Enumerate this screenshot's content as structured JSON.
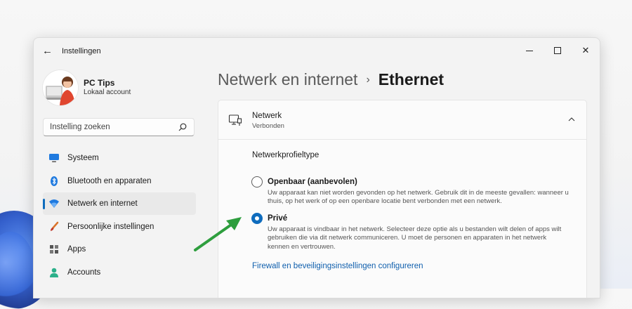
{
  "window": {
    "title": "Instellingen"
  },
  "user": {
    "name": "PC Tips",
    "account_type": "Lokaal account"
  },
  "search": {
    "placeholder": "Instelling zoeken"
  },
  "sidebar": {
    "items": [
      {
        "label": "Systeem",
        "icon": "monitor-icon"
      },
      {
        "label": "Bluetooth en apparaten",
        "icon": "bluetooth-icon"
      },
      {
        "label": "Netwerk en internet",
        "icon": "wifi-icon",
        "active": true
      },
      {
        "label": "Persoonlijke instellingen",
        "icon": "brush-icon"
      },
      {
        "label": "Apps",
        "icon": "apps-icon"
      },
      {
        "label": "Accounts",
        "icon": "person-icon"
      }
    ]
  },
  "breadcrumb": {
    "parent": "Netwerk en internet",
    "separator": "›",
    "current": "Ethernet"
  },
  "network_card": {
    "title": "Netwerk",
    "status": "Verbonden",
    "section_label": "Netwerkprofieltype",
    "options": [
      {
        "title": "Openbaar (aanbevolen)",
        "selected": false,
        "description": "Uw apparaat kan niet worden gevonden op het netwerk. Gebruik dit in de meeste gevallen: wanneer u thuis, op het werk of op een openbare locatie bent verbonden met een netwerk."
      },
      {
        "title": "Privé",
        "selected": true,
        "description": "Uw apparaat is vindbaar in het netwerk. Selecteer deze optie als u bestanden wilt delen of apps wilt gebruiken die via dit netwerk communiceren. U moet de personen en apparaten in het netwerk kennen en vertrouwen."
      }
    ],
    "link": "Firewall en beveiligingsinstellingen configureren"
  },
  "colors": {
    "accent": "#0f6cbd",
    "annotation_arrow": "#2e9e3e"
  }
}
